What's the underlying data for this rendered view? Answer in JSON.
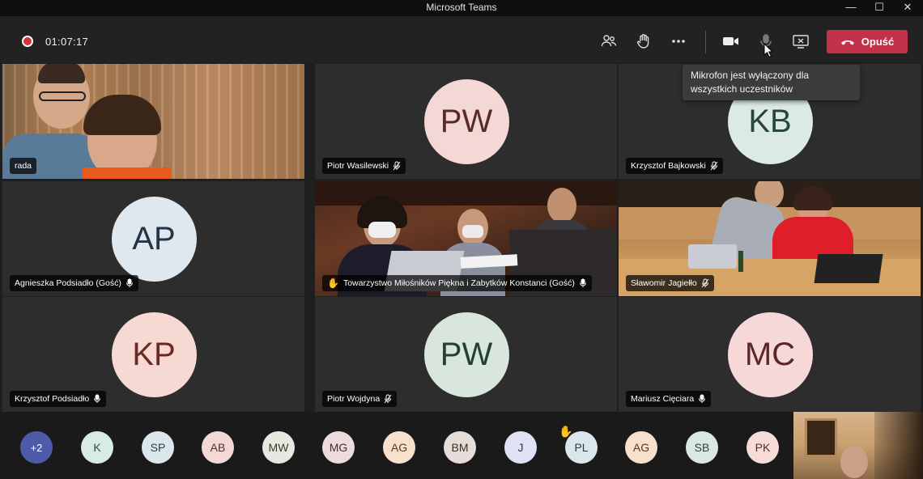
{
  "window": {
    "title": "Microsoft Teams",
    "minimize": "—",
    "maximize": "☐",
    "close": "✕"
  },
  "toolbar": {
    "timer": "01:07:17",
    "leave_label": "Opuść"
  },
  "tooltip": {
    "line1": "Mikrofon jest wyłączony dla",
    "line2": "wszystkich uczestników"
  },
  "tiles": [
    {
      "name": "rada",
      "type": "video"
    },
    {
      "name": "Piotr Wasilewski",
      "initials": "PW",
      "bg": "#f4d8d6",
      "fg": "#5a2a28"
    },
    {
      "name": "Krzysztof Bajkowski",
      "initials": "KB",
      "bg": "#dbeae5",
      "fg": "#27473e"
    },
    {
      "name": "Agnieszka Podsiadło (Gość)",
      "initials": "AP",
      "bg": "#dfe7ef",
      "fg": "#223548"
    },
    {
      "name": "Towarzystwo Miłośników Piękna i Zabytków Konstanci (Gość)",
      "type": "video"
    },
    {
      "name": "Sławomir Jagiełło",
      "type": "video"
    },
    {
      "name": "Krzysztof Podsiadło",
      "initials": "KP",
      "bg": "#f6d9d3",
      "fg": "#6a2a22"
    },
    {
      "name": "Piotr Wojdyna",
      "initials": "PW",
      "bg": "#d8e6dc",
      "fg": "#24402e"
    },
    {
      "name": "Mariusz Cięciara",
      "initials": "MC",
      "bg": "#f7d8d8",
      "fg": "#5c2626"
    }
  ],
  "strip": {
    "overflow": "+2",
    "participants": [
      {
        "initials": "K",
        "bg": "#d9ebe5",
        "fg": "#2a4a40"
      },
      {
        "initials": "SP",
        "bg": "#dbe7ea",
        "fg": "#28424a"
      },
      {
        "initials": "AB",
        "bg": "#f4d8d6",
        "fg": "#5a2a28"
      },
      {
        "initials": "MW",
        "bg": "#e8e8e0",
        "fg": "#3a3a30"
      },
      {
        "initials": "MG",
        "bg": "#eedcdc",
        "fg": "#4a2a2a"
      },
      {
        "initials": "AG",
        "bg": "#f7e1cc",
        "fg": "#5a3a18"
      },
      {
        "initials": "BM",
        "bg": "#e6ddd8",
        "fg": "#3a2e28"
      },
      {
        "initials": "J",
        "bg": "#dfe2f5",
        "fg": "#2a3060"
      },
      {
        "initials": "PL",
        "bg": "#dbe6ea",
        "fg": "#28424a"
      },
      {
        "initials": "AG",
        "bg": "#f7e1cc",
        "fg": "#5a3a18"
      },
      {
        "initials": "SB",
        "bg": "#dae8e4",
        "fg": "#28443e"
      },
      {
        "initials": "PK",
        "bg": "#f6dcd8",
        "fg": "#5c2a26"
      }
    ]
  }
}
